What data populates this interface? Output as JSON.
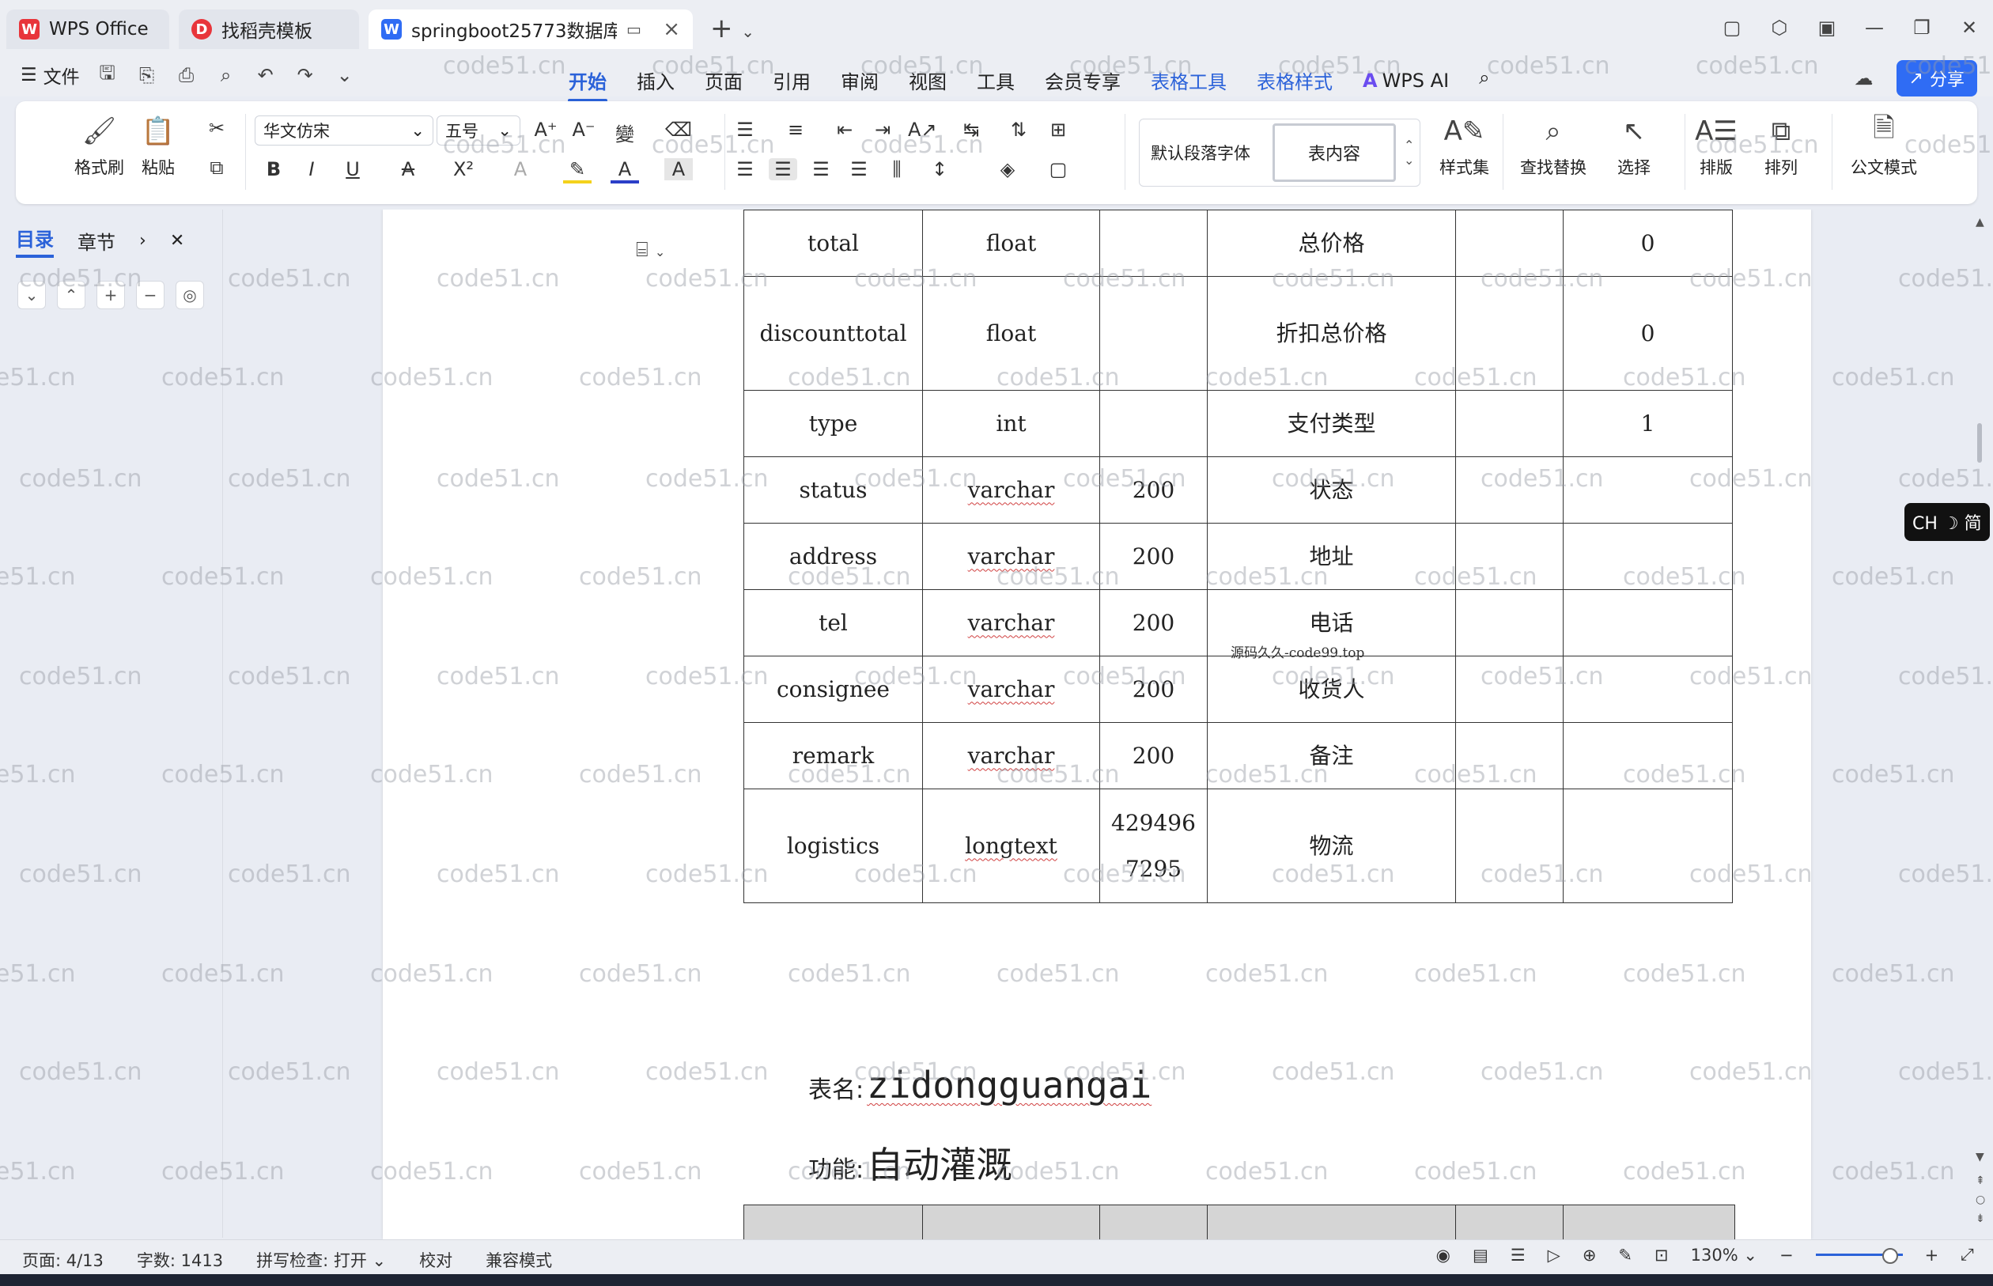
{
  "titlebar": {
    "tabs": [
      {
        "label": "WPS Office",
        "icon": "wps-icon"
      },
      {
        "label": "找稻壳模板",
        "icon": "docer-icon"
      },
      {
        "label": "springboot25773数据库文档",
        "icon": "writer-icon"
      }
    ]
  },
  "menubar": {
    "file_label": "文件",
    "tabs": [
      "开始",
      "插入",
      "页面",
      "引用",
      "审阅",
      "视图",
      "工具",
      "会员专享",
      "表格工具",
      "表格样式"
    ],
    "wps_ai": "WPS AI",
    "share_label": "分享"
  },
  "ribbon": {
    "format_painter": "格式刷",
    "paste": "粘贴",
    "font_name": "华文仿宋",
    "font_size": "五号",
    "style_default": "默认段落字体",
    "style_current": "表内容",
    "style_set": "样式集",
    "find_replace": "查找替换",
    "select": "选择",
    "layout": "排版",
    "arrange": "排列",
    "official_mode": "公文模式"
  },
  "navpane": {
    "tab_toc": "目录",
    "tab_chapter": "章节"
  },
  "table": {
    "rows": [
      {
        "name": "total",
        "type": "float",
        "length": "",
        "desc": "总价格",
        "key": "",
        "default": "0"
      },
      {
        "name": "discounttotal",
        "type": "float",
        "length": "",
        "desc": "折扣总价格",
        "key": "",
        "default": "0"
      },
      {
        "name": "type",
        "type": "int",
        "length": "",
        "desc": "支付类型",
        "key": "",
        "default": "1"
      },
      {
        "name": "status",
        "type": "varchar",
        "length": "200",
        "desc": "状态",
        "key": "",
        "default": ""
      },
      {
        "name": "address",
        "type": "varchar",
        "length": "200",
        "desc": "地址",
        "key": "",
        "default": ""
      },
      {
        "name": "tel",
        "type": "varchar",
        "length": "200",
        "desc": "电话",
        "key": "",
        "default": ""
      },
      {
        "name": "consignee",
        "type": "varchar",
        "length": "200",
        "desc": "收货人",
        "key": "",
        "default": ""
      },
      {
        "name": "remark",
        "type": "varchar",
        "length": "200",
        "desc": "备注",
        "key": "",
        "default": ""
      },
      {
        "name": "logistics",
        "type": "longtext",
        "length": "4294967295",
        "desc": "物流",
        "key": "",
        "default": ""
      }
    ]
  },
  "doc": {
    "inline_watermark": "源码久久-code99.top",
    "table_name_label": "表名:",
    "table_name_value": "zidongguangai",
    "function_label": "功能:",
    "function_value": "自动灌溉"
  },
  "ime": "CH ☽ 简",
  "statusbar": {
    "page": "页面: 4/13",
    "words": "字数: 1413",
    "spell": "拼写检查: 打开",
    "proof": "校对",
    "compat": "兼容模式",
    "zoom": "130%"
  },
  "watermark_text": "code51.cn",
  "colors": {
    "accent": "#2b62d9",
    "share": "#2f6cf4",
    "wps_red": "#e8353b"
  }
}
